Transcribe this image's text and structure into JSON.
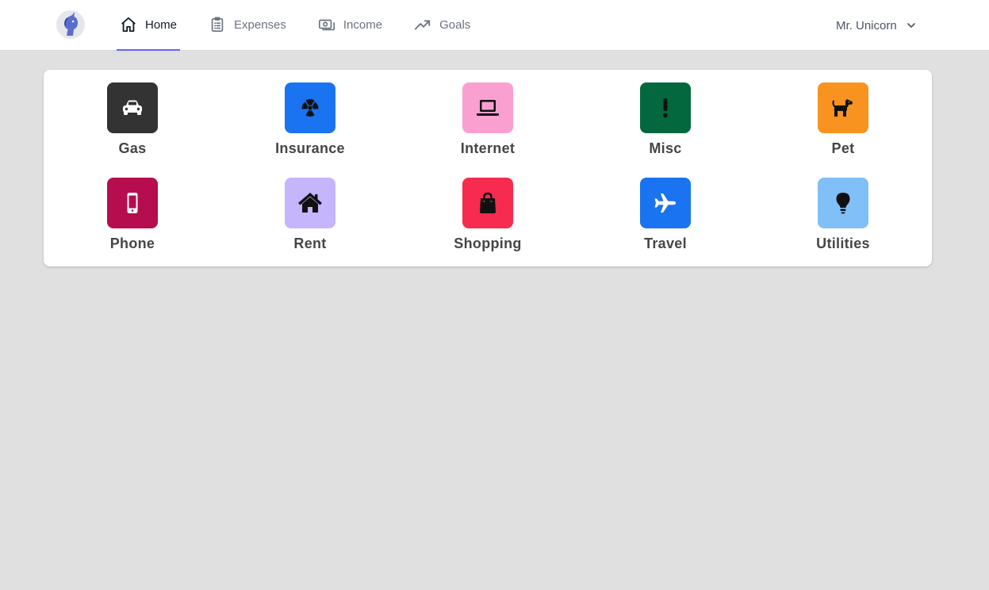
{
  "nav": {
    "items": [
      {
        "label": "Home",
        "icon": "home-icon",
        "active": true
      },
      {
        "label": "Expenses",
        "icon": "clipboard-icon"
      },
      {
        "label": "Income",
        "icon": "cash-icon"
      },
      {
        "label": "Goals",
        "icon": "trending-up-icon"
      }
    ],
    "active_color": "#6366f1"
  },
  "user": {
    "name": "Mr. Unicorn",
    "icon": "chevron-down-icon"
  },
  "categories": [
    {
      "label": "Gas",
      "icon": "car-icon",
      "color": "#333333"
    },
    {
      "label": "Insurance",
      "icon": "radiation-icon",
      "color": "#1a73f0"
    },
    {
      "label": "Internet",
      "icon": "laptop-icon",
      "color": "#f9a0d0"
    },
    {
      "label": "Misc",
      "icon": "exclamation-icon",
      "color": "#04683f"
    },
    {
      "label": "Pet",
      "icon": "dog-icon",
      "color": "#f99320"
    },
    {
      "label": "Phone",
      "icon": "mobile-phone-icon",
      "color": "#b60d4f"
    },
    {
      "label": "Rent",
      "icon": "house-icon",
      "color": "#c4b5fd"
    },
    {
      "label": "Shopping",
      "icon": "shopping-bag-icon",
      "color": "#f72a50"
    },
    {
      "label": "Travel",
      "icon": "airplane-icon",
      "color": "#1a73f0"
    },
    {
      "label": "Utilities",
      "icon": "lightbulb-icon",
      "color": "#80bff8"
    }
  ]
}
